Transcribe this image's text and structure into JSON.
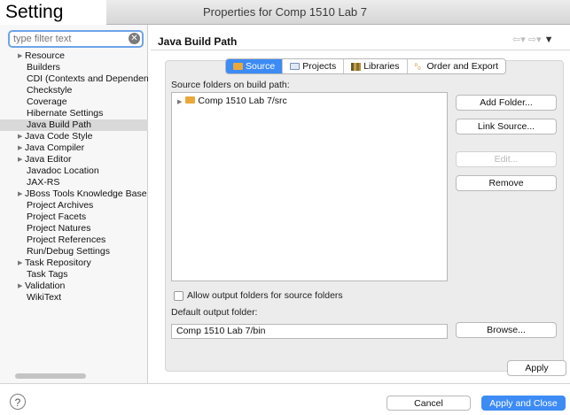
{
  "window": {
    "title": "Properties for Comp 1510 Lab 7",
    "overlay_caption": "Setting",
    "traffic_colors": [
      "#fe5f57",
      "#febb2e",
      "#29c940"
    ]
  },
  "sidebar": {
    "filter_placeholder": "type filter text",
    "items": [
      {
        "label": "Resource",
        "expandable": true
      },
      {
        "label": "Builders",
        "expandable": false
      },
      {
        "label": "CDI (Contexts and Dependency Injection)",
        "expandable": false
      },
      {
        "label": "Checkstyle",
        "expandable": false
      },
      {
        "label": "Coverage",
        "expandable": false
      },
      {
        "label": "Hibernate Settings",
        "expandable": false
      },
      {
        "label": "Java Build Path",
        "expandable": false,
        "selected": true
      },
      {
        "label": "Java Code Style",
        "expandable": true
      },
      {
        "label": "Java Compiler",
        "expandable": true
      },
      {
        "label": "Java Editor",
        "expandable": true
      },
      {
        "label": "Javadoc Location",
        "expandable": false
      },
      {
        "label": "JAX-RS",
        "expandable": false
      },
      {
        "label": "JBoss Tools Knowledge Base",
        "expandable": true
      },
      {
        "label": "Project Archives",
        "expandable": false
      },
      {
        "label": "Project Facets",
        "expandable": false
      },
      {
        "label": "Project Natures",
        "expandable": false
      },
      {
        "label": "Project References",
        "expandable": false
      },
      {
        "label": "Run/Debug Settings",
        "expandable": false
      },
      {
        "label": "Task Repository",
        "expandable": true
      },
      {
        "label": "Task Tags",
        "expandable": false
      },
      {
        "label": "Validation",
        "expandable": true
      },
      {
        "label": "WikiText",
        "expandable": false
      }
    ]
  },
  "main": {
    "title": "Java Build Path",
    "tabs": [
      {
        "label": "Source",
        "icon": "source-folder-icon",
        "active": true
      },
      {
        "label": "Projects",
        "icon": "projects-icon",
        "active": false
      },
      {
        "label": "Libraries",
        "icon": "libraries-icon",
        "active": false
      },
      {
        "label": "Order and Export",
        "icon": "order-export-icon",
        "active": false
      }
    ],
    "source_label": "Source folders on build path:",
    "source_folder": "Comp 1510 Lab 7/src",
    "buttons": {
      "add_folder": "Add Folder...",
      "link_source": "Link Source...",
      "edit": "Edit...",
      "remove": "Remove",
      "browse": "Browse...",
      "apply": "Apply"
    },
    "allow_output_label": "Allow output folders for source folders",
    "allow_output_checked": false,
    "default_output_label": "Default output folder:",
    "default_output_value": "Comp 1510 Lab 7/bin"
  },
  "footer": {
    "help": "?",
    "cancel": "Cancel",
    "apply_close": "Apply and Close"
  },
  "colors": {
    "accent": "#3d8bf4",
    "focus_ring": "#6ea4e9"
  }
}
